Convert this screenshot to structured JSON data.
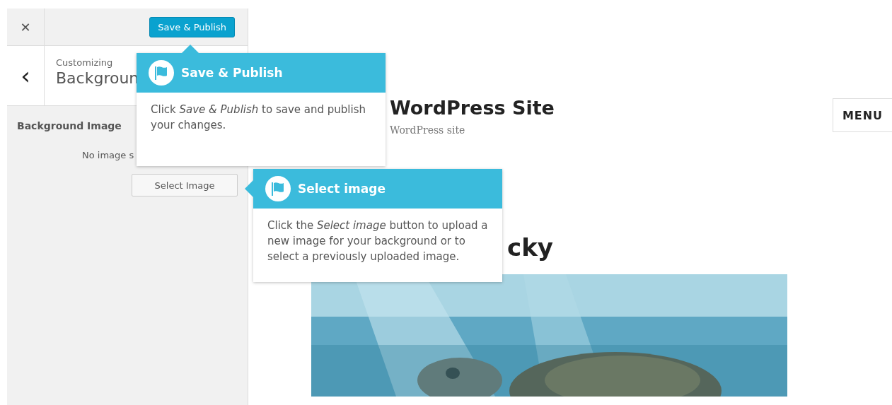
{
  "sidebar": {
    "close_icon_char": "✕",
    "save_button": "Save & Publish",
    "back_char": "‹",
    "header_caption": "Customizing",
    "header_title": "Backgroun",
    "section_title": "Background Image",
    "no_image_text": "No image s",
    "select_button": "Select Image"
  },
  "preview": {
    "site_title": "WordPress Site",
    "tagline": "WordPress site",
    "menu_button": "MENU",
    "post_title": "cky"
  },
  "tours": [
    {
      "title": "Save & Publish",
      "body": "Click *Save & Publish* to save and publish your changes.",
      "kind": "pointer-top"
    },
    {
      "title": "Select image",
      "body": "Click the *Select image* button to upload a new image for your background or to select a previously uploaded image.",
      "kind": "pointer-left"
    }
  ]
}
